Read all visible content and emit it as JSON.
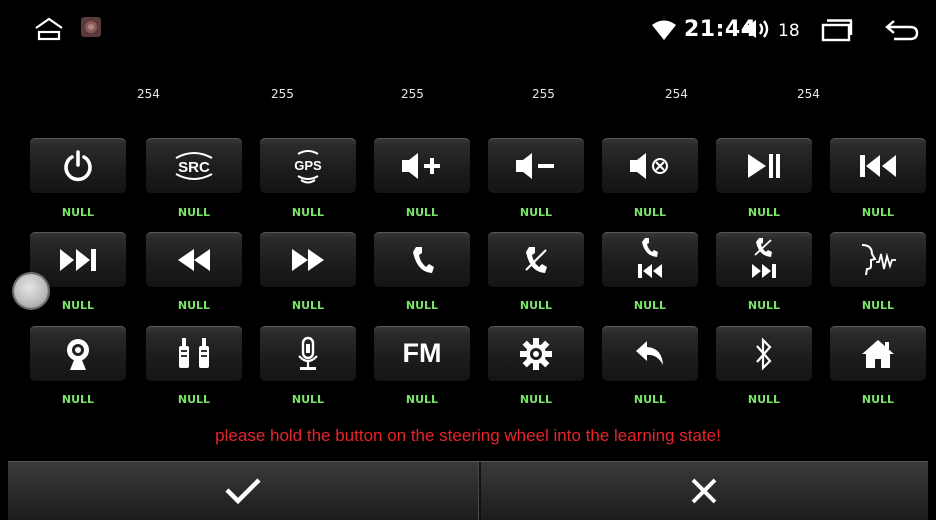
{
  "status_bar": {
    "time": "21:44",
    "volume": "18"
  },
  "learned_values": [
    "254",
    "255",
    "255",
    "255",
    "254",
    "254"
  ],
  "buttons": [
    {
      "icon": "power-icon",
      "label": "NULL"
    },
    {
      "icon": "src-icon",
      "text": "SRC",
      "label": "NULL"
    },
    {
      "icon": "gps-icon",
      "text": "GPS",
      "label": "NULL"
    },
    {
      "icon": "volume-up-icon",
      "label": "NULL"
    },
    {
      "icon": "volume-down-icon",
      "label": "NULL"
    },
    {
      "icon": "mute-icon",
      "label": "NULL"
    },
    {
      "icon": "play-pause-icon",
      "label": "NULL"
    },
    {
      "icon": "previous-track-icon",
      "label": "NULL"
    },
    {
      "icon": "next-track-icon",
      "label": "NULL"
    },
    {
      "icon": "rewind-icon",
      "label": "NULL"
    },
    {
      "icon": "fast-forward-icon",
      "label": "NULL"
    },
    {
      "icon": "phone-answer-icon",
      "label": "NULL"
    },
    {
      "icon": "phone-hangup-icon",
      "label": "NULL"
    },
    {
      "icon": "phone-previous-icon",
      "label": "NULL"
    },
    {
      "icon": "phone-next-icon",
      "label": "NULL"
    },
    {
      "icon": "voice-icon",
      "label": "NULL"
    },
    {
      "icon": "camera-icon",
      "label": "NULL"
    },
    {
      "icon": "aux-icon",
      "label": "NULL"
    },
    {
      "icon": "microphone-icon",
      "label": "NULL"
    },
    {
      "icon": "fm-icon",
      "text": "FM",
      "label": "NULL"
    },
    {
      "icon": "settings-icon",
      "label": "NULL"
    },
    {
      "icon": "back-icon",
      "label": "NULL"
    },
    {
      "icon": "bluetooth-icon",
      "label": "NULL"
    },
    {
      "icon": "home-icon",
      "label": "NULL"
    }
  ],
  "message": "please hold the button on the steering wheel into the learning state!",
  "actions": {
    "confirm_icon": "check-icon",
    "cancel_icon": "close-icon"
  },
  "colors": {
    "label_green": "#7ce36a",
    "message_red": "#e8242a"
  }
}
